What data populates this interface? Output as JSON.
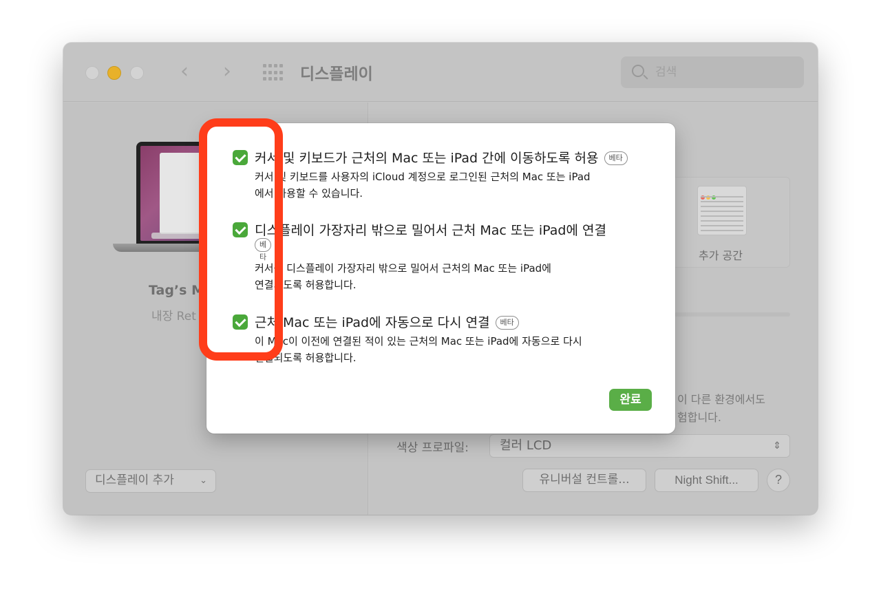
{
  "window": {
    "title": "디스플레이",
    "search_placeholder": "검색",
    "nav_back": "‹",
    "nav_forward": "›"
  },
  "left_pane": {
    "display_name": "Tag’s M",
    "display_subtitle": "내장 Ret",
    "add_display_label": "디스플레이 추가",
    "add_display_chevron": "⌄"
  },
  "right_pane": {
    "more_space_label": "추가 공간",
    "background_desc_line1": "이 다른 환경에서도",
    "background_desc_line2": "험합니다.",
    "color_profile_label": "색상 프로파일:",
    "color_profile_value": "컬러 LCD",
    "universal_control_button": "유니버설 컨트롤...",
    "night_shift_button": "Night Shift...",
    "help_button": "?"
  },
  "sheet": {
    "options": [
      {
        "title": "커서 및 키보드가 근처의 Mac 또는 iPad 간에 이동하도록 허용",
        "beta": "베타",
        "desc_line1": "커서 및 키보드를 사용자의 iCloud 계정으로 로그인된 근처의 Mac 또는 iPad",
        "desc_line2": "에서 사용할 수 있습니다.",
        "checked": true
      },
      {
        "title": "디스플레이 가장자리 밖으로 밀어서 근처 Mac 또는 iPad에 연결",
        "beta": "베타",
        "desc_line1": "커서를 디스플레이 가장자리 밖으로 밀어서 근처의 Mac 또는 iPad에",
        "desc_line2": "연결되도록 허용합니다.",
        "checked": true
      },
      {
        "title": "근처 Mac 또는 iPad에 자동으로 다시 연결",
        "beta": "베타",
        "desc_line1": "이 Mac이 이전에 연결된 적이 있는 근처의 Mac 또는 iPad에 자동으로 다시",
        "desc_line2": "연결되도록 허용합니다.",
        "checked": true
      }
    ],
    "done_button": "완료"
  },
  "colors": {
    "checkbox_green": "#4aa83a",
    "done_green": "#5aae47",
    "highlight_red": "#ff3d1a",
    "minimize_yellow": "#e8b12a"
  }
}
